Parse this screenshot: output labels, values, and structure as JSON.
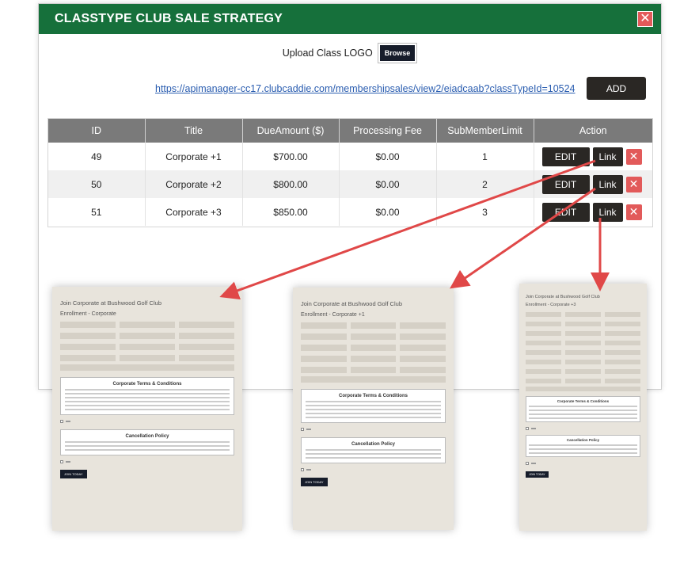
{
  "modal": {
    "title": "CLASSTYPE CLUB SALE STRATEGY",
    "close_icon": "close-icon",
    "upload_label": "Upload Class LOGO",
    "browse_label": "Browse",
    "url": "https://apimanager-cc17.clubcaddie.com/membershipsales/view2/eiadcaab?classTypeId=10524",
    "add_label": "ADD"
  },
  "table": {
    "headers": [
      "ID",
      "Title",
      "DueAmount ($)",
      "Processing Fee",
      "SubMemberLimit",
      "Action"
    ],
    "rows": [
      {
        "id": "49",
        "title": "Corporate +1",
        "due": "$700.00",
        "fee": "$0.00",
        "limit": "1"
      },
      {
        "id": "50",
        "title": "Corporate +2",
        "due": "$800.00",
        "fee": "$0.00",
        "limit": "2"
      },
      {
        "id": "51",
        "title": "Corporate +3",
        "due": "$850.00",
        "fee": "$0.00",
        "limit": "3"
      }
    ],
    "edit_label": "EDIT",
    "link_label": "Link"
  },
  "forms": [
    {
      "title": "Join Corporate at Bushwood Golf Club",
      "enroll": "Enrollment - Corporate",
      "terms": "Corporate Terms & Conditions",
      "cancel": "Cancellation Policy",
      "join": "JOIN TODAY"
    },
    {
      "title": "Join Corporate at Bushwood Golf Club",
      "enroll": "Enrollment - Corporate +1",
      "terms": "Corporate Terms & Conditions",
      "cancel": "Cancellation Policy",
      "join": "JOIN TODAY"
    },
    {
      "title": "Join Corporate at Bushwood Golf Club",
      "enroll": "Enrollment - Corporate +3",
      "terms": "Corporate Terms & Conditions",
      "cancel": "Cancellation Policy",
      "join": "JOIN TODAY"
    }
  ],
  "colors": {
    "header": "#16703b",
    "dark_button": "#2a2724",
    "delete": "#e25a5a",
    "arrow": "#e04848"
  }
}
